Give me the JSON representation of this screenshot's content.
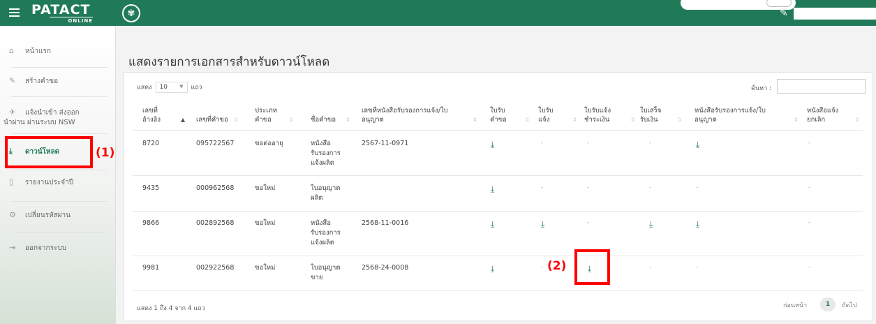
{
  "topbar": {
    "logo_text": "PATACT",
    "logo_sub": "ONLINE",
    "notif_icon": "notification-icon",
    "colors": {
      "brand": "#217a57",
      "accent_red": "#ff0000"
    }
  },
  "sidebar": {
    "items": [
      {
        "label": "หน้าแรก",
        "icon": "home-icon"
      },
      {
        "label": "สร้างคำขอ",
        "icon": "pencil-icon"
      },
      {
        "label": "แจ้งนำเข้า ส่งออก",
        "label2": "นำผ่าน ผ่านระบบ NSW",
        "icon": "plane-icon"
      },
      {
        "label": "ดาวน์โหลด",
        "icon": "download-icon",
        "active": true
      },
      {
        "label": "รายงานประจำปี",
        "icon": "file-icon"
      },
      {
        "label": "เปลี่ยนรหัสผ่าน",
        "icon": "gears-icon"
      },
      {
        "label": "ออกจากระบบ",
        "icon": "logout-icon"
      }
    ]
  },
  "annotations": {
    "label1": "(1)",
    "label2": "(2)"
  },
  "main": {
    "title": "แสดงรายการเอกสารสำหรับดาวน์โหลด",
    "length_prefix": "แสดง",
    "length_value": "10",
    "length_suffix": "แถว",
    "search_label": "ค้นหา :",
    "search_value": "",
    "info": "แสดง 1 ถึง 4 จาก 4 แถว",
    "prev_label": "ก่อนหน้า",
    "page": "1",
    "next_label": "ถัดไป"
  },
  "table": {
    "headers": [
      [
        "เลขที่",
        "อ้างอิง"
      ],
      [
        "เลขที่คำขอ"
      ],
      [
        "ประเภท",
        "คำขอ"
      ],
      [
        "ชื่อคำขอ"
      ],
      [
        "เลขที่หนังสือรับรองการแจ้ง/ใบ",
        "อนุญาต"
      ],
      [
        "ใบรับ",
        "คำขอ"
      ],
      [
        "ใบรับ",
        "แจ้ง"
      ],
      [
        "ใบรับแจ้ง",
        "ชำระเงิน"
      ],
      [
        "ใบเสร็จ",
        "รับเงิน"
      ],
      [
        "หนังสือรับรองการแจ้ง/ใบ",
        "อนุญาต"
      ],
      [
        "หนังสือแจ้ง",
        "ยกเลิก"
      ]
    ],
    "rows": [
      {
        "ref": "8720",
        "req_no": "095722567",
        "type": "ขอต่ออายุ",
        "name": [
          "หนังสือ",
          "รับรองการ",
          "แจ้งผลิต"
        ],
        "cert_no": "2567-11-0971",
        "cells": [
          "download",
          "-",
          "-",
          "-",
          "download",
          "-"
        ]
      },
      {
        "ref": "9435",
        "req_no": "000962568",
        "type": "ขอใหม่",
        "name": [
          "ใบอนุญาต",
          "ผลิต"
        ],
        "cert_no": "",
        "cells": [
          "download",
          "-",
          "-",
          "-",
          "-",
          "-"
        ]
      },
      {
        "ref": "9866",
        "req_no": "002892568",
        "type": "ขอใหม่",
        "name": [
          "หนังสือ",
          "รับรองการ",
          "แจ้งผลิต"
        ],
        "cert_no": "2568-11-0016",
        "cells": [
          "download",
          "download",
          "-",
          "download",
          "download",
          "-"
        ]
      },
      {
        "ref": "9981",
        "req_no": "002922568",
        "type": "ขอใหม่",
        "name": [
          "ใบอนุญาต",
          "ขาย"
        ],
        "cert_no": "2568-24-0008",
        "cells": [
          "download",
          "-",
          "download",
          "-",
          "-",
          "-"
        ]
      }
    ]
  }
}
